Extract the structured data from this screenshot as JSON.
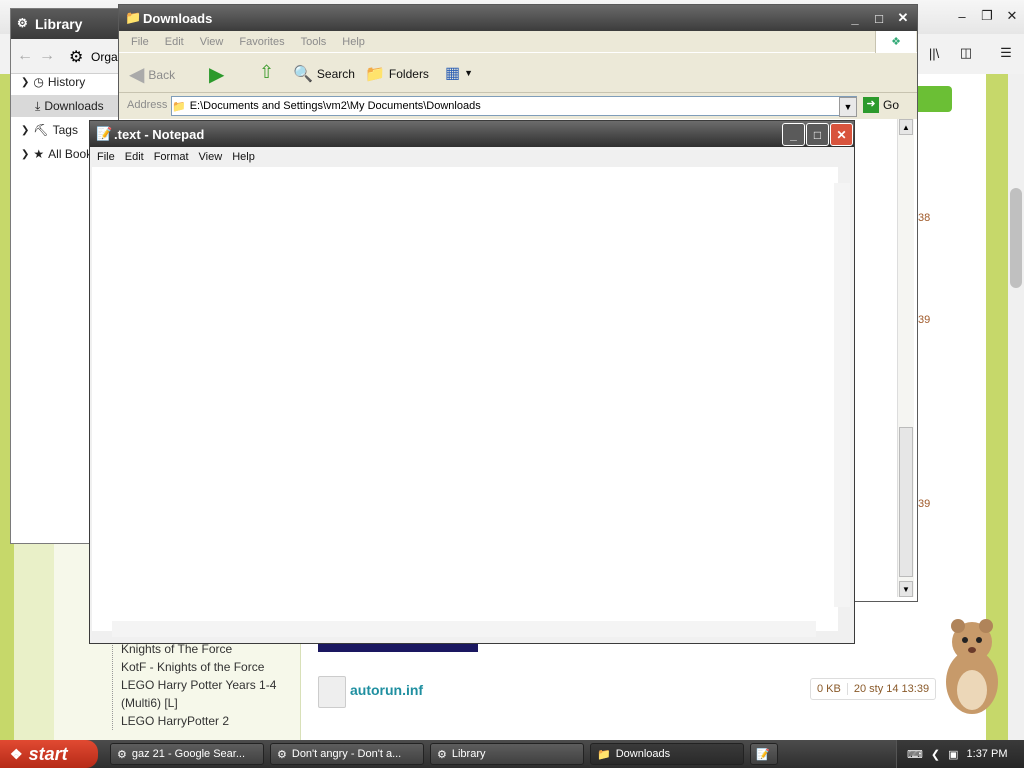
{
  "browser": {
    "tree_items": [
      "Knights of The Force",
      "KotF - Knights of the Force",
      "LEGO Harry Potter Years 1-4 (Multi6) [L]",
      "LEGO HarryPotter 2"
    ],
    "file": {
      "name": "autorun.inf",
      "size": "0 KB",
      "date": "20 sty 14 13:39"
    },
    "side_times": [
      "38",
      "39",
      "39"
    ]
  },
  "library": {
    "title": "Library",
    "organize_label": "Orga",
    "items": [
      {
        "label": "History",
        "icon": "clock-icon"
      },
      {
        "label": "Downloads",
        "icon": "download-icon"
      },
      {
        "label": "Tags",
        "icon": "tag-icon"
      },
      {
        "label": "All Book",
        "icon": "star-icon"
      }
    ]
  },
  "explorer": {
    "title": "Downloads",
    "menu": [
      "File",
      "Edit",
      "View",
      "Favorites",
      "Tools",
      "Help"
    ],
    "toolbar": {
      "back": "Back",
      "search": "Search",
      "folders": "Folders"
    },
    "address_label": "Address",
    "address_value": "E:\\Documents and Settings\\vm2\\My Documents\\Downloads",
    "go_label": "Go"
  },
  "notepad": {
    "title": ".text - Notepad",
    "menu": [
      "File",
      "Edit",
      "Format",
      "View",
      "Help"
    ],
    "content": ""
  },
  "taskbar": {
    "start_label": "start",
    "tasks": [
      "gaz 21 - Google Sear...",
      "Don't angry - Don't a...",
      "Library",
      "Downloads"
    ],
    "clock": "1:37 PM"
  },
  "colors": {
    "accent": "#d8543d",
    "title_dark": "#3c3c3c",
    "link": "#1f8fa0"
  }
}
